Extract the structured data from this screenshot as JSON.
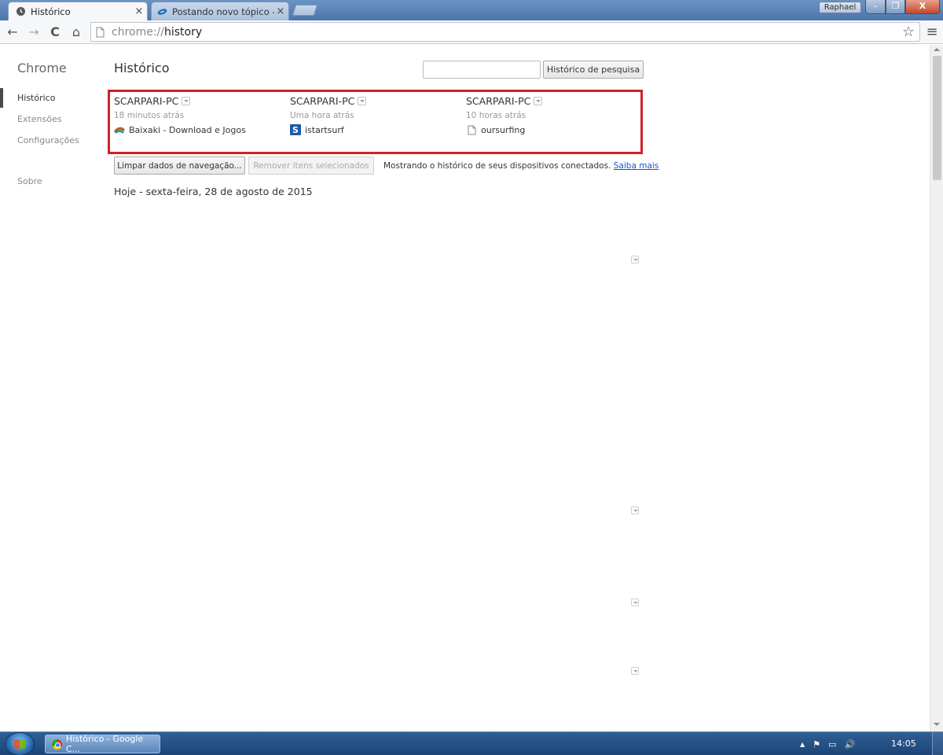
{
  "browser": {
    "tabs": [
      {
        "label": "Histórico",
        "close": "×"
      },
      {
        "label": "Postando novo tópico - Fó",
        "close": "×"
      }
    ],
    "user_badge": "Raphael",
    "window_buttons": {
      "minimize": "–",
      "maximize": "❐",
      "close": "X"
    },
    "toolbar": {
      "back": "←",
      "forward": "→",
      "reload": "C",
      "home": "⌂",
      "url_scheme": "chrome://",
      "url_host": "history",
      "bookmark_star": "☆",
      "menu": "≡"
    }
  },
  "sidebar": {
    "title": "Chrome",
    "items": [
      {
        "label": "Histórico",
        "selected": true
      },
      {
        "label": "Extensões"
      },
      {
        "label": "Configurações"
      },
      {
        "label": "Sobre"
      }
    ]
  },
  "history": {
    "title": "Histórico",
    "search": {
      "value": "",
      "button_label": "Histórico de pesquisa"
    },
    "devices": [
      {
        "name": "SCARPARI-PC",
        "time": "18 minutos atrás",
        "tab_title": "Baixaki - Download e Jogos",
        "icon": "baixaki-icon"
      },
      {
        "name": "SCARPARI-PC",
        "time": "Uma hora atrás",
        "tab_title": "istartsurf",
        "icon": "istartsurf-icon",
        "icon_letter": "S"
      },
      {
        "name": "SCARPARI-PC",
        "time": "10 horas atrás",
        "tab_title": "oursurfing",
        "icon": "page-icon"
      }
    ],
    "clear_button": "Limpar dados de navegação...",
    "remove_button": "Remover itens selecionados",
    "info_text": "Mostrando o histórico de seus dispositivos conectados.",
    "learn_more": "Saiba mais",
    "day_heading": "Hoje - sexta-feira, 28 de agosto de 2015"
  },
  "taskbar": {
    "task_label": "Histórico - Google C...",
    "tray": {
      "show_hidden": "▲",
      "flag": "⚑",
      "network": "▭",
      "volume": "🔊"
    },
    "clock": "14:05"
  },
  "colors": {
    "highlight_border": "#d0202a",
    "link": "#1155cc"
  }
}
